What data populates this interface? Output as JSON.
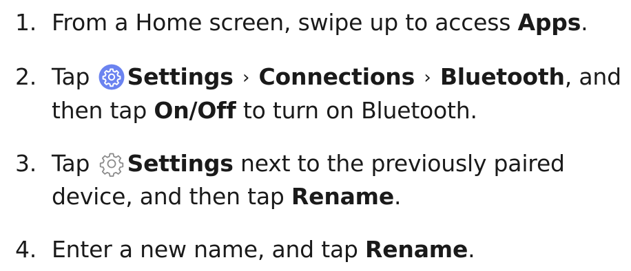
{
  "steps": [
    {
      "number": "1.",
      "text_before": "From a Home screen, swipe up to access ",
      "bold": "Apps",
      "text_after": "."
    },
    {
      "number": "2.",
      "text_tap": "Tap",
      "icon": "settings-gear-filled-icon",
      "settings": "Settings",
      "sep1": "›",
      "connections": "Connections",
      "sep2": "›",
      "bluetooth": "Bluetooth",
      "text_mid": ", and then tap ",
      "onoff": "On/Off",
      "text_after": " to turn on Bluetooth."
    },
    {
      "number": "3.",
      "text_tap": "Tap",
      "icon": "settings-gear-outline-icon",
      "settings": "Settings",
      "text_mid": " next to the previously paired device, and then tap ",
      "rename": "Rename",
      "text_after": "."
    },
    {
      "number": "4.",
      "text_before": "Enter a new name, and tap ",
      "rename": "Rename",
      "text_after": "."
    }
  ],
  "colors": {
    "text": "#1a1a1a",
    "settings_icon_bg": "#6b83f0",
    "settings_icon_fg": "#ffffff",
    "outline_icon": "#8a8a8a"
  }
}
